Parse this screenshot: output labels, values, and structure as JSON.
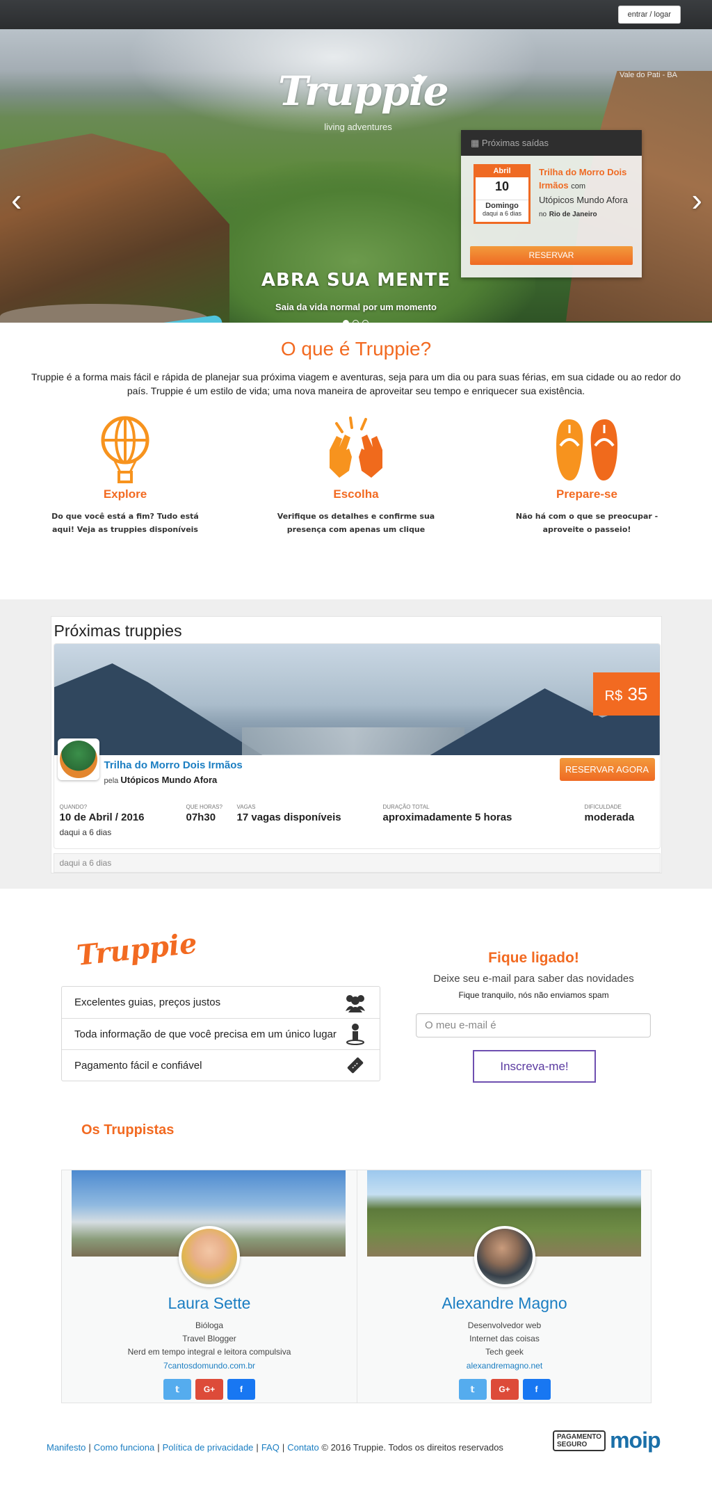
{
  "topbar": {
    "login_label": "entrar / logar"
  },
  "hero": {
    "logo": "Truppie",
    "logo_sub": "living adventures",
    "location": "Vale do Pati - BA",
    "caption_title": "ABRA SUA MENTE",
    "caption_sub": "Saia da vida normal por um momento",
    "prev_icon": "chevron-left-icon",
    "next_icon": "chevron-right-icon",
    "slides": 3,
    "active_slide": 1,
    "upcoming": {
      "header": "Próximas saídas",
      "month": "Abril",
      "day": "10",
      "weekday": "Domingo",
      "in_days": "daqui a 6 dias",
      "trip_name": "Trilha do Morro Dois Irmãos",
      "with": "com",
      "organizer": "Utópicos Mundo Afora",
      "location_prefix": "no",
      "location": "Rio de Janeiro",
      "reserve_label": "RESERVAR"
    }
  },
  "what": {
    "title": "O que é Truppie?",
    "lead": "Truppie é a forma mais fácil e rápida de planejar sua próxima viagem e aventuras, seja para um dia ou para suas férias, em sua cidade ou ao redor do país. Truppie é um estilo de vida; uma nova maneira de aproveitar seu tempo e enriquecer sua existência.",
    "features": [
      {
        "title": "Explore",
        "desc": "Do que você está a fim? Tudo está aqui! Veja as truppies disponíveis",
        "icon": "hot-air-balloon-icon"
      },
      {
        "title": "Escolha",
        "desc": "Verifique os detalhes e confirme sua presença com apenas um clique",
        "icon": "high-five-icon"
      },
      {
        "title": "Prepare-se",
        "desc": "Não há com o que se preocupar - aproveite o passeio!",
        "icon": "flip-flops-icon"
      }
    ]
  },
  "trips": {
    "title": "Próximas truppies",
    "price_currency": "R$",
    "price_value": "35",
    "trip_title": "Trilha do Morro Dois Irmãos",
    "by_label": "pela",
    "organizer": "Utópicos Mundo Afora",
    "reserve_label": "RESERVAR AGORA",
    "when_label": "QUANDO?",
    "when_value": "10 de Abril / 2016",
    "when_note": "daqui a 6 dias",
    "hour_label": "QUE HORAS?",
    "hour_value": "07h30",
    "spots_label": "VAGAS",
    "spots_value": "17 vagas disponíveis",
    "duration_label": "DURAÇÃO TOTAL",
    "duration_value": "aproximadamente 5 horas",
    "difficulty_label": "DIFICULDADE",
    "difficulty_value": "moderada",
    "footer_note": "daqui a 6 dias"
  },
  "perks": {
    "brand": "Truppie",
    "items": [
      {
        "label": "Excelentes guias, preços justos",
        "icon": "group-icon"
      },
      {
        "label": "Toda informação de que você precisa em um único lugar",
        "icon": "info-person-icon"
      },
      {
        "label": "Pagamento fácil e confiável",
        "icon": "ticket-icon"
      }
    ]
  },
  "subscribe": {
    "title": "Fique ligado!",
    "text": "Deixe seu e-mail para saber das novidades",
    "small": "Fique tranquilo, nós não enviamos spam",
    "placeholder": "O meu e-mail é",
    "button": "Inscreva-me!"
  },
  "team": {
    "title": "Os Truppistas",
    "members": [
      {
        "name": "Laura Sette",
        "line1": "Bióloga",
        "line2": "Travel Blogger",
        "line3": "Nerd em tempo integral e leitora compulsiva",
        "link": "7cantosdomundo.com.br"
      },
      {
        "name": "Alexandre Magno",
        "line1": "Desenvolvedor web",
        "line2": "Internet das coisas",
        "line3": "Tech geek",
        "link": "alexandremagno.net"
      }
    ],
    "social": {
      "twitter": "twitter-icon",
      "gplus": "G+",
      "facebook": "facebook-icon"
    }
  },
  "footer": {
    "links": [
      "Manifesto",
      "Como funciona",
      "Política de privacidade",
      "FAQ",
      "Contato"
    ],
    "copyright": "© 2016 Truppie. Todos os direitos reservados",
    "seal_line1": "PAGAMENTO",
    "seal_line2": "SEGURO",
    "payment_brand": "moip"
  },
  "colors": {
    "accent": "#f26a21",
    "link": "#1b7ec2",
    "subscribe": "#6e4fb0"
  }
}
